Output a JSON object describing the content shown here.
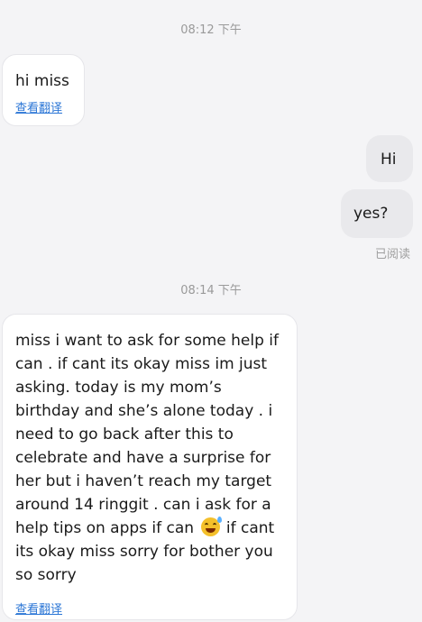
{
  "chat": {
    "time1": "08:12 下午",
    "msg1": {
      "text": "hi miss",
      "translate": "查看翻译"
    },
    "reply1": "Hi",
    "reply2": "yes?",
    "read_status": "已阅读",
    "time2": "08:14 下午",
    "msg2": {
      "text_before_emoji": "miss i want to ask for some help if\ncan . if cant its okay miss im just\nasking. today is my mom’s\nbirthday and she’s alone today . i\nneed to go back after this to\ncelebrate and have a surprise for\nher but i haven’t reach my target\naround 14 ringgit . can i ask for a\nhelp tips on apps if can ",
      "emoji": "grinning-sweat-emoji",
      "text_after_emoji": " if cant\nits okay miss sorry for bother you\nso sorry",
      "translate": "查看翻译"
    }
  }
}
